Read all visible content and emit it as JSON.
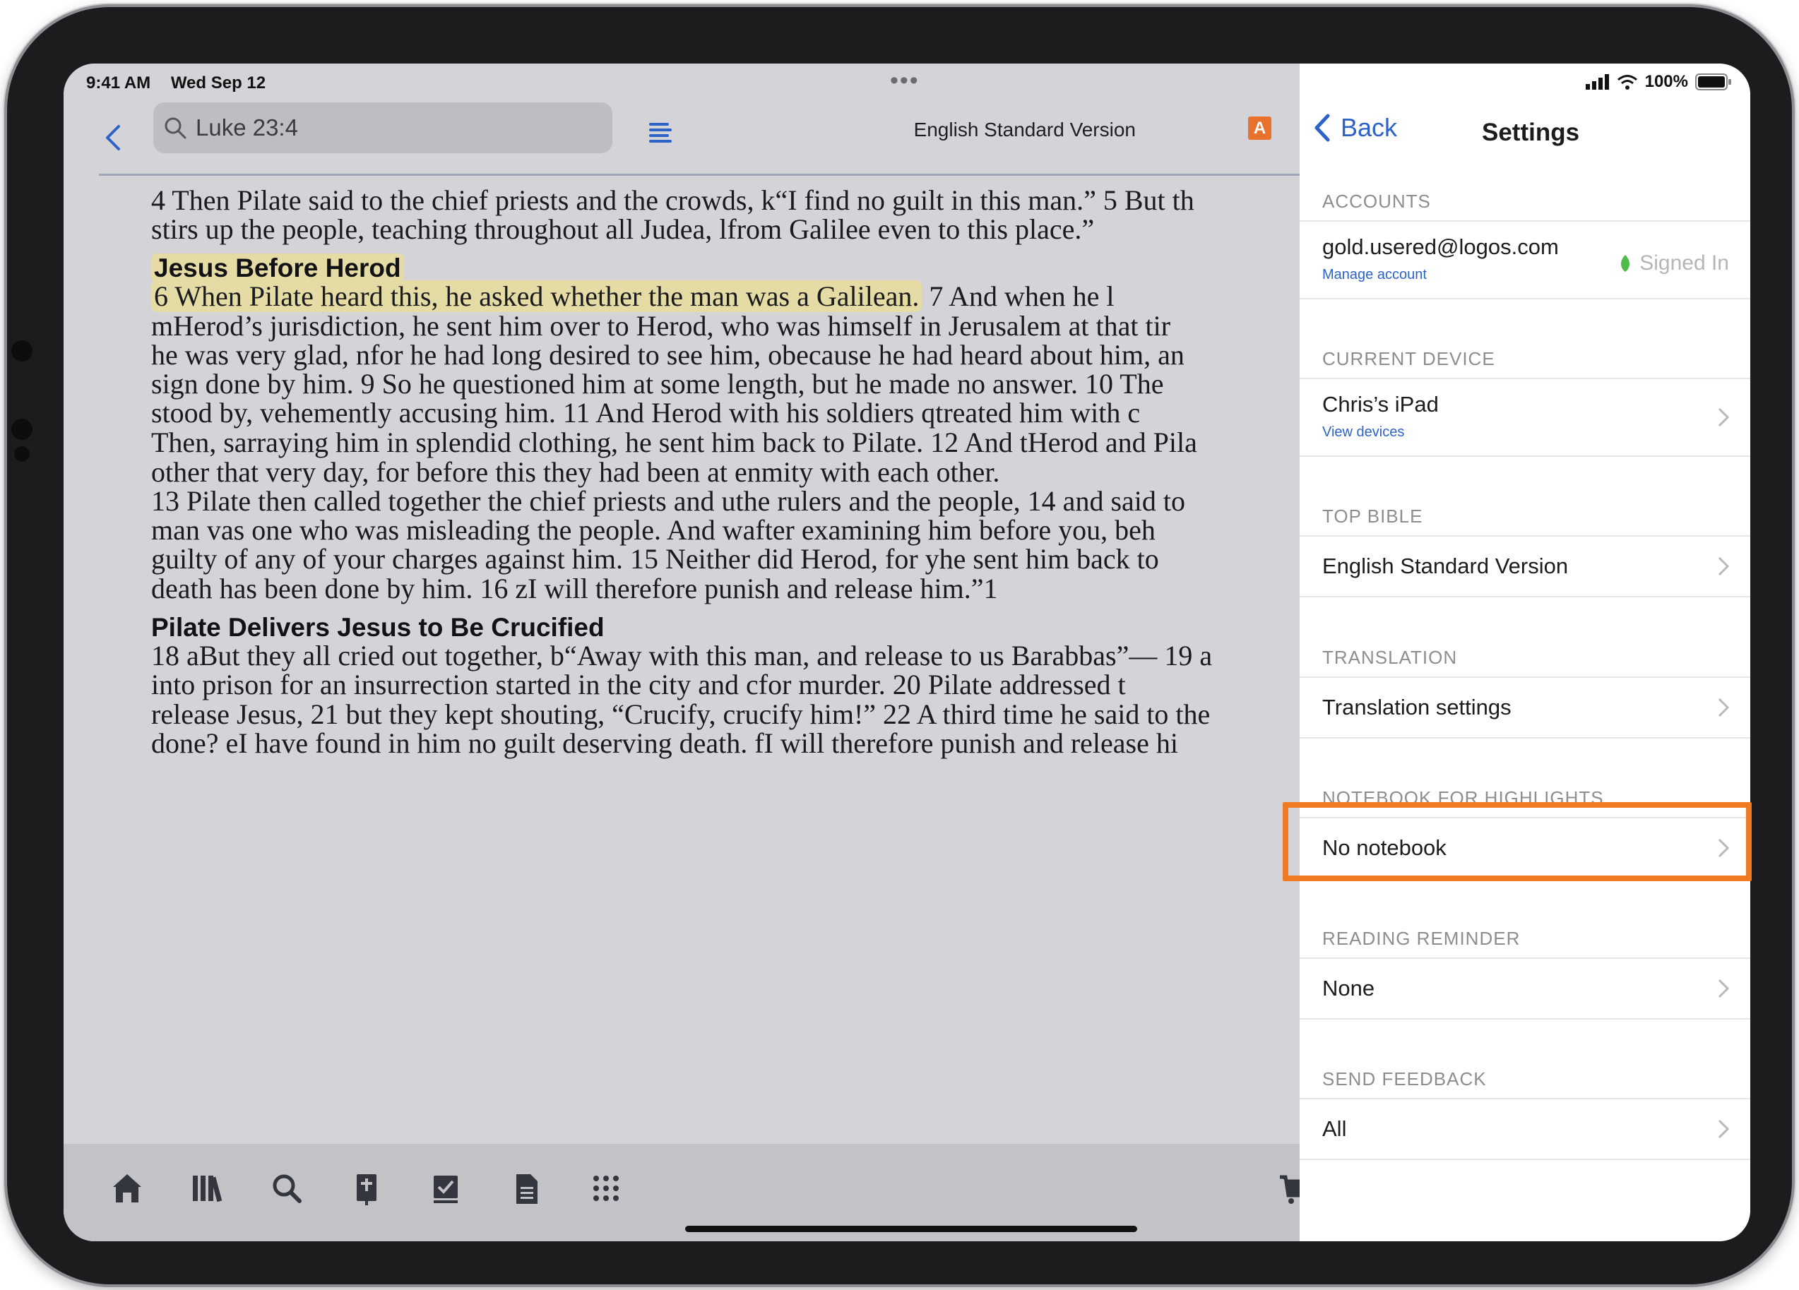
{
  "status_bar": {
    "time": "9:41 AM",
    "date": "Wed Sep 12",
    "battery": "100%"
  },
  "reader": {
    "search_text": "Luke 23:4",
    "version": "English Standard Version",
    "version_badge": "A",
    "lines": [
      "4 Then Pilate said to the chief priests and the crowds, k“I find no guilt in this man.” 5 But th",
      "stirs up the people, teaching throughout all Judea, lfrom Galilee even to this place.”",
      "Jesus Before Herod",
      "6 When Pilate heard this, he asked whether the man was a Galilean. 7 And when he l",
      "mHerod’s jurisdiction, he sent him over to Herod, who was himself in Jerusalem at that tir",
      "he was very glad, nfor he had long desired to see him, obecause he had heard about him, an",
      "sign done by him. 9 So he questioned him at some length, but he made no answer. 10 The",
      "stood by, vehemently accusing him. 11 And Herod with his soldiers qtreated him with c",
      "Then, sarraying him in splendid clothing, he sent him back to Pilate. 12 And tHerod and Pila",
      "other that very day, for before this they had been at enmity with each other.",
      "13 Pilate then called together the chief priests and uthe rulers and the people, 14 and said to",
      "man vas one who was misleading the people. And wafter examining him before you, beh",
      "guilty of any of your charges against him. 15 Neither did Herod, for yhe sent him back to",
      "death has been done by him. 16 zI will therefore punish and release him.”1",
      "Pilate Delivers Jesus to Be Crucified",
      "18 aBut they all cried out together, b“Away with this man, and release to us Barabbas”— 19 a",
      "into prison for an insurrection started in the city and cfor murder. 20 Pilate addressed t",
      "release Jesus, 21 but they kept shouting, “Crucify, crucify him!” 22 A third time he said to the",
      "done? eI have found in him no guilt deserving death. fI will therefore punish and release hi"
    ]
  },
  "tabbar": {
    "icons": [
      "home-icon",
      "library-icon",
      "search-icon",
      "bible-icon",
      "checklist-icon",
      "document-icon",
      "apps-grid-icon",
      "cart-icon"
    ]
  },
  "settings": {
    "back_label": "Back",
    "title": "Settings",
    "accounts": {
      "header": "ACCOUNTS",
      "email": "gold.usered@logos.com",
      "manage": "Manage account",
      "status": "Signed In"
    },
    "current_device": {
      "header": "CURRENT DEVICE",
      "name": "Chris’s iPad",
      "link": "View devices"
    },
    "top_bible": {
      "header": "TOP BIBLE",
      "value": "English Standard Version"
    },
    "translation": {
      "header": "TRANSLATION",
      "value": "Translation settings"
    },
    "notebook": {
      "header": "NOTEBOOK FOR HIGHLIGHTS",
      "value": "No notebook"
    },
    "reading_reminder": {
      "header": "READING REMINDER",
      "value": "None"
    },
    "send_feedback": {
      "header": "SEND FEEDBACK",
      "value": "All"
    }
  },
  "colors": {
    "accent_blue": "#2d63c8",
    "highlight_orange": "#f07a24",
    "verse_highlight": "#e4dca4"
  }
}
